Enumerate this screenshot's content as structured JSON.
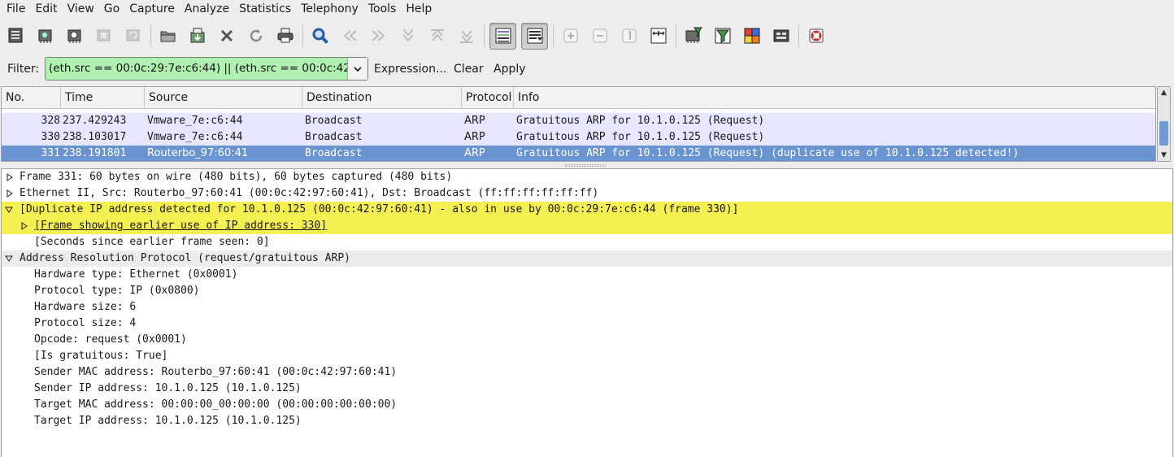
{
  "menu": [
    "File",
    "Edit",
    "View",
    "Go",
    "Capture",
    "Analyze",
    "Statistics",
    "Telephony",
    "Tools",
    "Help"
  ],
  "toolbar": {
    "icons": [
      "interface-list-icon",
      "capture-options-icon",
      "start-capture-icon",
      "stop-capture-icon",
      "restart-capture-icon",
      "open-file-icon",
      "save-file-icon",
      "close-file-icon",
      "reload-icon",
      "print-icon",
      "find-packet-icon",
      "go-back-icon",
      "go-forward-icon",
      "go-to-packet-icon",
      "go-first-icon",
      "go-last-icon",
      "colorize-icon",
      "auto-scroll-icon",
      "zoom-in-icon",
      "zoom-out-icon",
      "normal-size-icon",
      "resize-columns-icon",
      "capture-filters-icon",
      "display-filters-icon",
      "coloring-rules-icon",
      "preferences-icon",
      "help-icon"
    ]
  },
  "filter": {
    "label": "Filter:",
    "value": "(eth.src == 00:0c:29:7e:c6:44) || (eth.src == 00:0c:42",
    "expression_label": "Expression...",
    "clear_label": "Clear",
    "apply_label": "Apply"
  },
  "packet_list": {
    "columns": [
      "No.",
      "Time",
      "Source",
      "Destination",
      "Protocol",
      "Info"
    ],
    "rows": [
      {
        "no": "328",
        "time": "237.429243",
        "source": "Vmware_7e:c6:44",
        "destination": "Broadcast",
        "protocol": "ARP",
        "info": "Gratuitous ARP for 10.1.0.125 (Request)"
      },
      {
        "no": "330",
        "time": "238.103017",
        "source": "Vmware_7e:c6:44",
        "destination": "Broadcast",
        "protocol": "ARP",
        "info": "Gratuitous ARP for 10.1.0.125 (Request)"
      },
      {
        "no": "331",
        "time": "238.191801",
        "source": "Routerbo_97:60:41",
        "destination": "Broadcast",
        "protocol": "ARP",
        "info": "Gratuitous ARP for 10.1.0.125 (Request) (duplicate use of 10.1.0.125 detected!)"
      }
    ]
  },
  "details": [
    "Frame 331: 60 bytes on wire (480 bits), 60 bytes captured (480 bits)",
    "Ethernet II, Src: Routerbo_97:60:41 (00:0c:42:97:60:41), Dst: Broadcast (ff:ff:ff:ff:ff:ff)",
    "[Duplicate IP address detected for 10.1.0.125 (00:0c:42:97:60:41) - also in use by 00:0c:29:7e:c6:44 (frame 330)]",
    "[Frame showing earlier use of IP address: 330]",
    "[Seconds since earlier frame seen: 0]",
    "Address Resolution Protocol (request/gratuitous ARP)",
    "Hardware type: Ethernet (0x0001)",
    "Protocol type: IP (0x0800)",
    "Hardware size: 6",
    "Protocol size: 4",
    "Opcode: request (0x0001)",
    "[Is gratuitous: True]",
    "Sender MAC address: Routerbo_97:60:41 (00:0c:42:97:60:41)",
    "Sender IP address: 10.1.0.125 (10.1.0.125)",
    "Target MAC address: 00:00:00_00:00:00 (00:00:00:00:00:00)",
    "Target IP address: 10.1.0.125 (10.1.0.125)"
  ],
  "colors": {
    "filter_valid": "#b0f0b0",
    "arp_row": "#e7e6ff",
    "selected_row": "#6a94cf",
    "expert_warning": "#f5f052"
  }
}
